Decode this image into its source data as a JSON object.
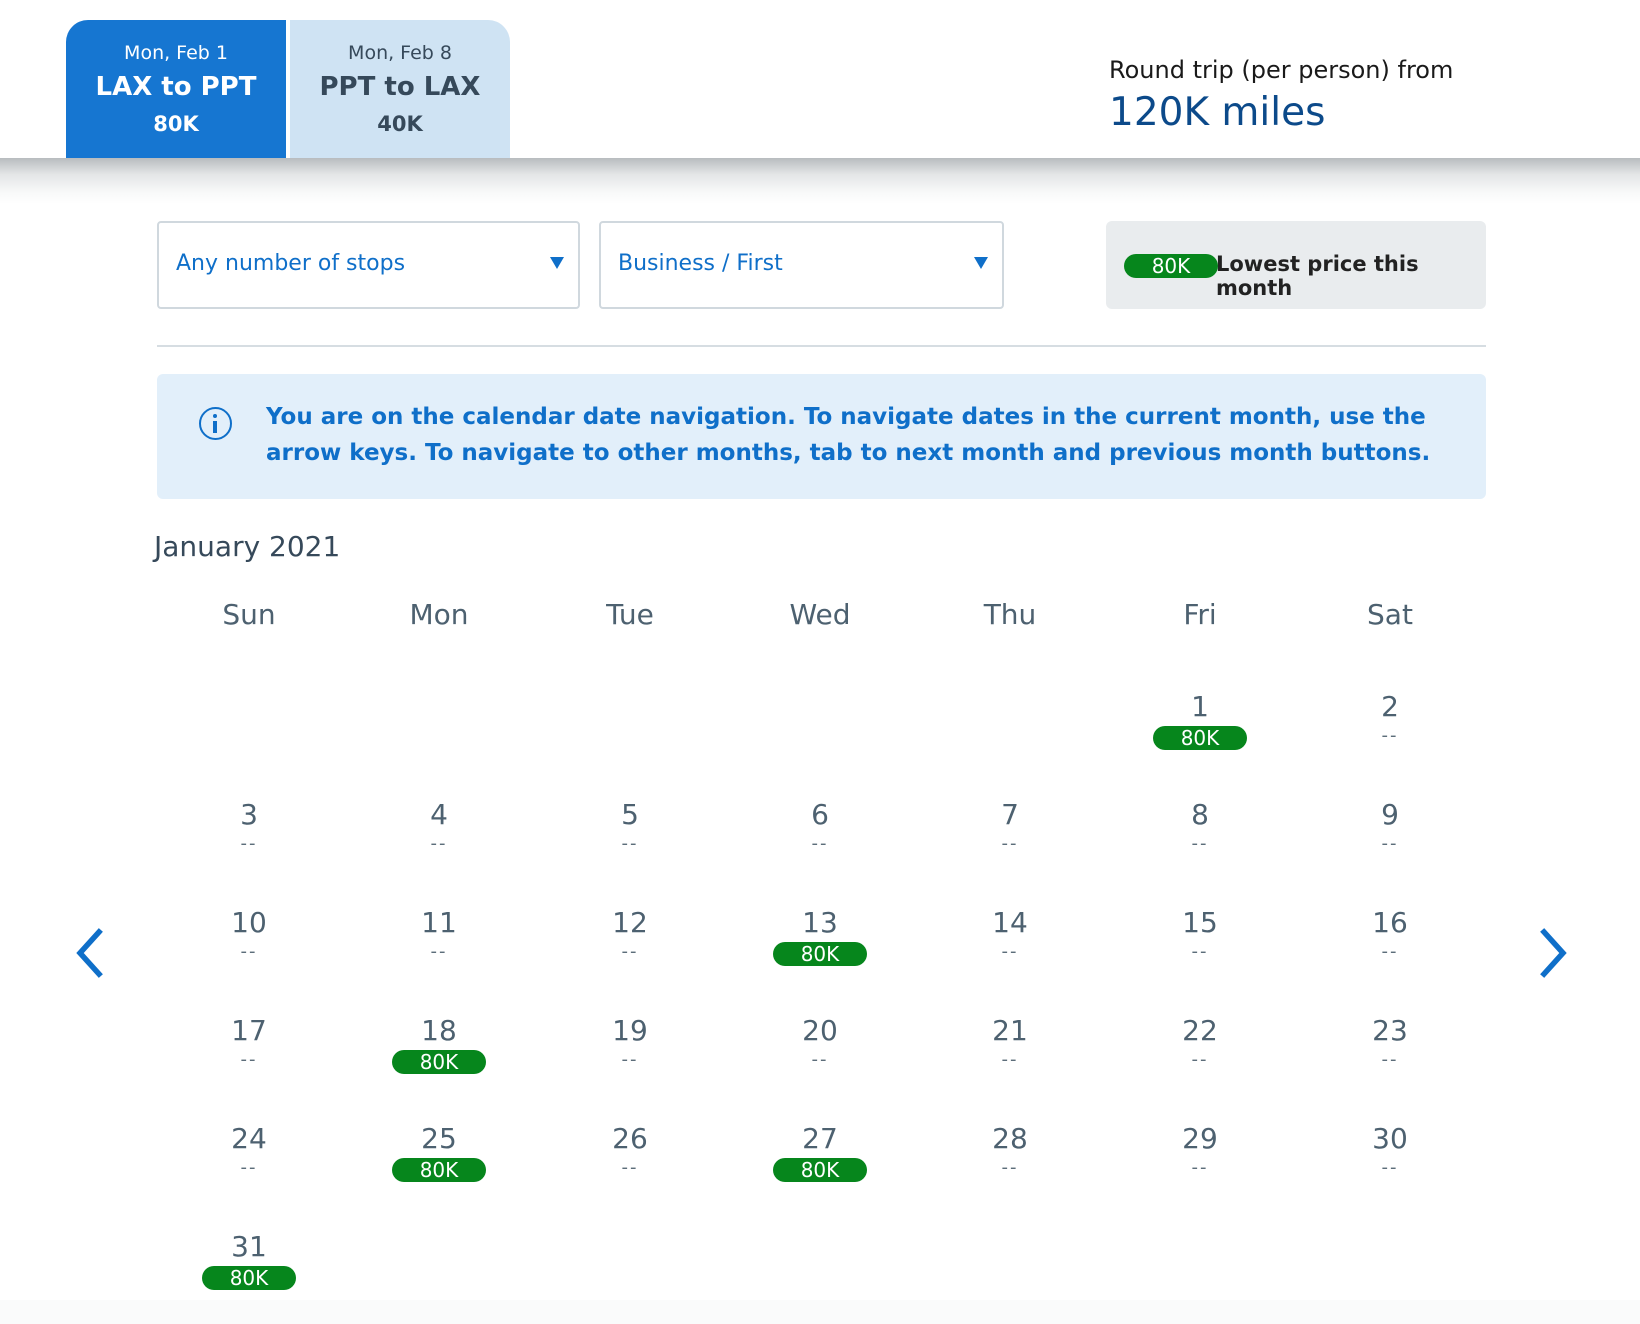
{
  "trip_tabs": [
    {
      "date": "Mon, Feb 1",
      "route": "LAX to PPT",
      "price": "80K",
      "selected": true
    },
    {
      "date": "Mon, Feb 8",
      "route": "PPT to LAX",
      "price": "40K",
      "selected": false
    }
  ],
  "summary": {
    "label": "Round trip (per person) from",
    "value": "120K miles"
  },
  "filters": {
    "stops": {
      "selected": "Any number of stops"
    },
    "cabin": {
      "selected": "Business / First"
    }
  },
  "legend": {
    "badge": "80K",
    "text": "Lowest price this month"
  },
  "info_banner": {
    "icon": "info-icon",
    "text": "You are on the calendar date navigation. To navigate dates in the current month, use the arrow keys. To navigate to other months, tab to next month and previous month buttons."
  },
  "calendar": {
    "month_title": "January 2021",
    "weekdays": [
      "Sun",
      "Mon",
      "Tue",
      "Wed",
      "Thu",
      "Fri",
      "Sat"
    ],
    "first_weekday_index": 5,
    "no_price_text": "--",
    "days": [
      {
        "day": "1",
        "price": "80K"
      },
      {
        "day": "2",
        "price": null
      },
      {
        "day": "3",
        "price": null
      },
      {
        "day": "4",
        "price": null
      },
      {
        "day": "5",
        "price": null
      },
      {
        "day": "6",
        "price": null
      },
      {
        "day": "7",
        "price": null
      },
      {
        "day": "8",
        "price": null
      },
      {
        "day": "9",
        "price": null
      },
      {
        "day": "10",
        "price": null
      },
      {
        "day": "11",
        "price": null
      },
      {
        "day": "12",
        "price": null
      },
      {
        "day": "13",
        "price": "80K"
      },
      {
        "day": "14",
        "price": null
      },
      {
        "day": "15",
        "price": null
      },
      {
        "day": "16",
        "price": null
      },
      {
        "day": "17",
        "price": null
      },
      {
        "day": "18",
        "price": "80K"
      },
      {
        "day": "19",
        "price": null
      },
      {
        "day": "20",
        "price": null
      },
      {
        "day": "21",
        "price": null
      },
      {
        "day": "22",
        "price": null
      },
      {
        "day": "23",
        "price": null
      },
      {
        "day": "24",
        "price": null
      },
      {
        "day": "25",
        "price": "80K"
      },
      {
        "day": "26",
        "price": null
      },
      {
        "day": "27",
        "price": "80K"
      },
      {
        "day": "28",
        "price": null
      },
      {
        "day": "29",
        "price": null
      },
      {
        "day": "30",
        "price": null
      },
      {
        "day": "31",
        "price": "80K"
      }
    ],
    "prev_month_icon": "chevron-left-icon",
    "next_month_icon": "chevron-right-icon"
  },
  "colors": {
    "accent": "#1676d1",
    "link_blue": "#0f6fc9",
    "price_green": "#06861c",
    "summary_blue": "#0c4a8a",
    "tab_inactive": "#cfe3f3",
    "info_bg": "#e2effa"
  }
}
